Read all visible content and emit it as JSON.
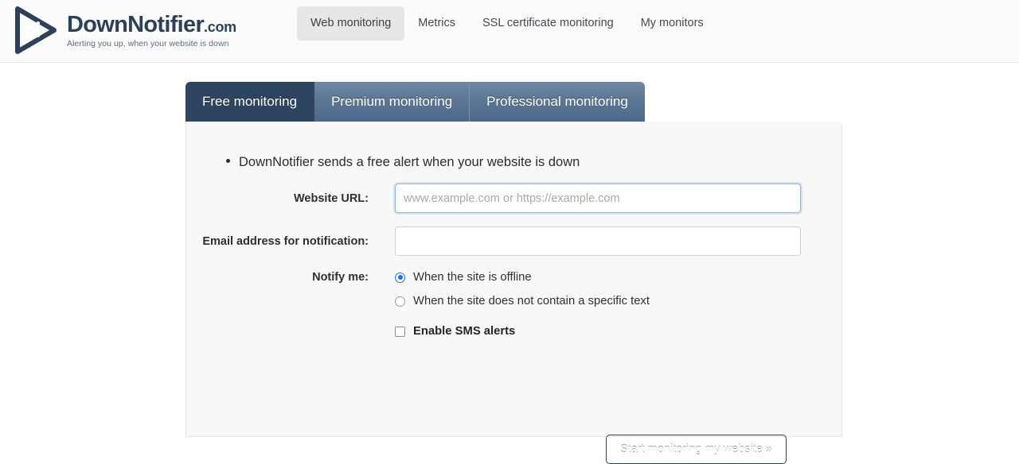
{
  "header": {
    "logo": {
      "icon": "downnotifier-play-logo",
      "name": "DownNotifier",
      "tld": ".com",
      "tagline": "Alerting you up, when your website is down"
    },
    "nav": [
      {
        "label": "Web monitoring",
        "active": true
      },
      {
        "label": "Metrics",
        "active": false
      },
      {
        "label": "SSL certificate monitoring",
        "active": false
      },
      {
        "label": "My monitors",
        "active": false
      }
    ]
  },
  "plan_tabs": [
    {
      "label": "Free monitoring",
      "active": true
    },
    {
      "label": "Premium monitoring",
      "active": false
    },
    {
      "label": "Professional monitoring",
      "active": false
    }
  ],
  "panel": {
    "bullet": "DownNotifier sends a free alert when your website is down",
    "fields": {
      "url": {
        "label": "Website URL:",
        "value": "",
        "placeholder": "www.example.com or https://example.com",
        "focused": true
      },
      "email": {
        "label": "Email address for notification:",
        "value": "",
        "placeholder": "",
        "focused": false
      }
    },
    "notify": {
      "label": "Notify me:",
      "options": [
        {
          "label": "When the site is offline",
          "selected": true
        },
        {
          "label": "When the site does not contain a specific text",
          "selected": false
        }
      ],
      "sms": {
        "label": "Enable SMS alerts",
        "checked": false
      }
    },
    "submit_label": "Start monitoring my website »"
  },
  "colors": {
    "brand_navy": "#2e4561",
    "tab_inactive": "#5c7694",
    "accent_blue": "#1a73e8",
    "panel_bg": "#f8f8f9"
  }
}
